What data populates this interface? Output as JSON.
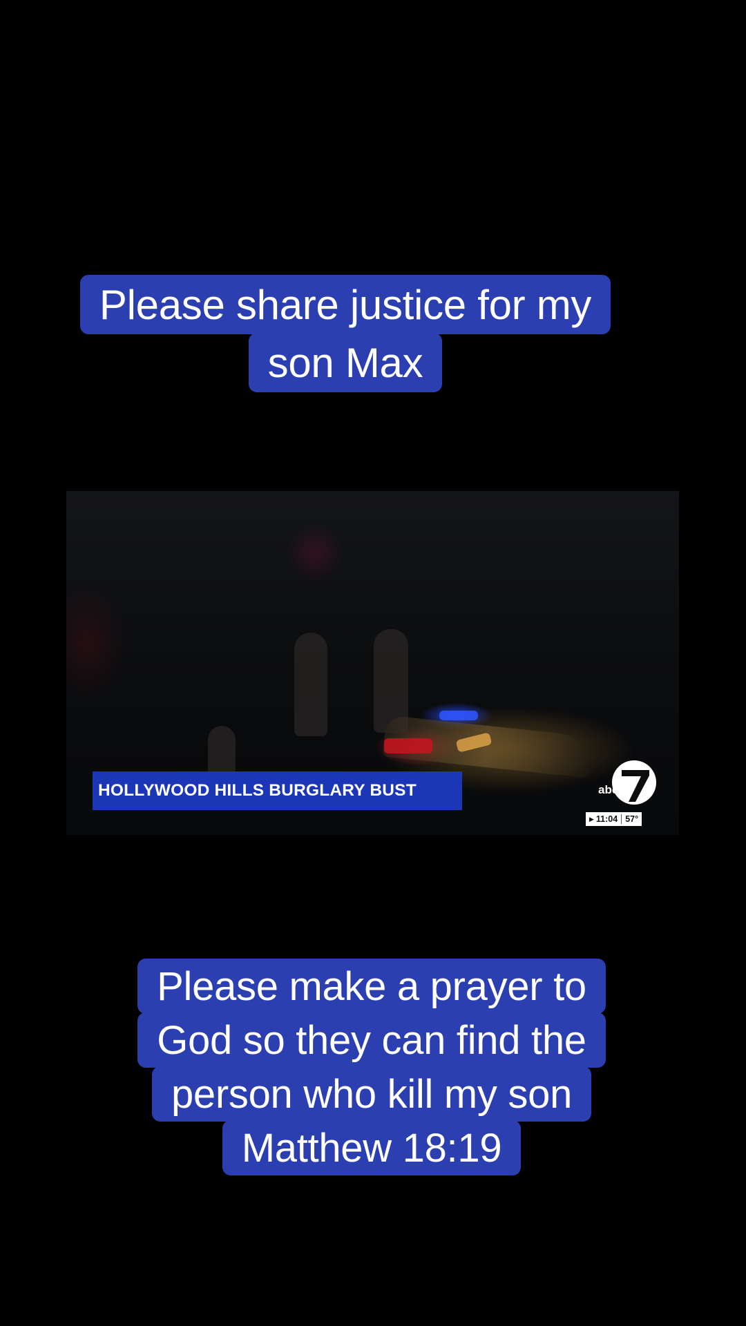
{
  "captions": {
    "top": {
      "line1": "Please share justice for my",
      "line2": "son Max "
    },
    "bottom": {
      "line1": "Please make a prayer to",
      "line2": "God so they can find the",
      "line3": "person who kill my son",
      "line4": "Matthew 18:19"
    }
  },
  "video": {
    "lower_third": "HOLLYWOOD HILLS BURGLARY BUST",
    "logo_text": "abc",
    "logo_number": "7",
    "clock": "11:04",
    "temperature": "57°",
    "colors": {
      "lower_third_bg": "#1c36b8",
      "caption_bg": "#2b3fb0"
    }
  }
}
